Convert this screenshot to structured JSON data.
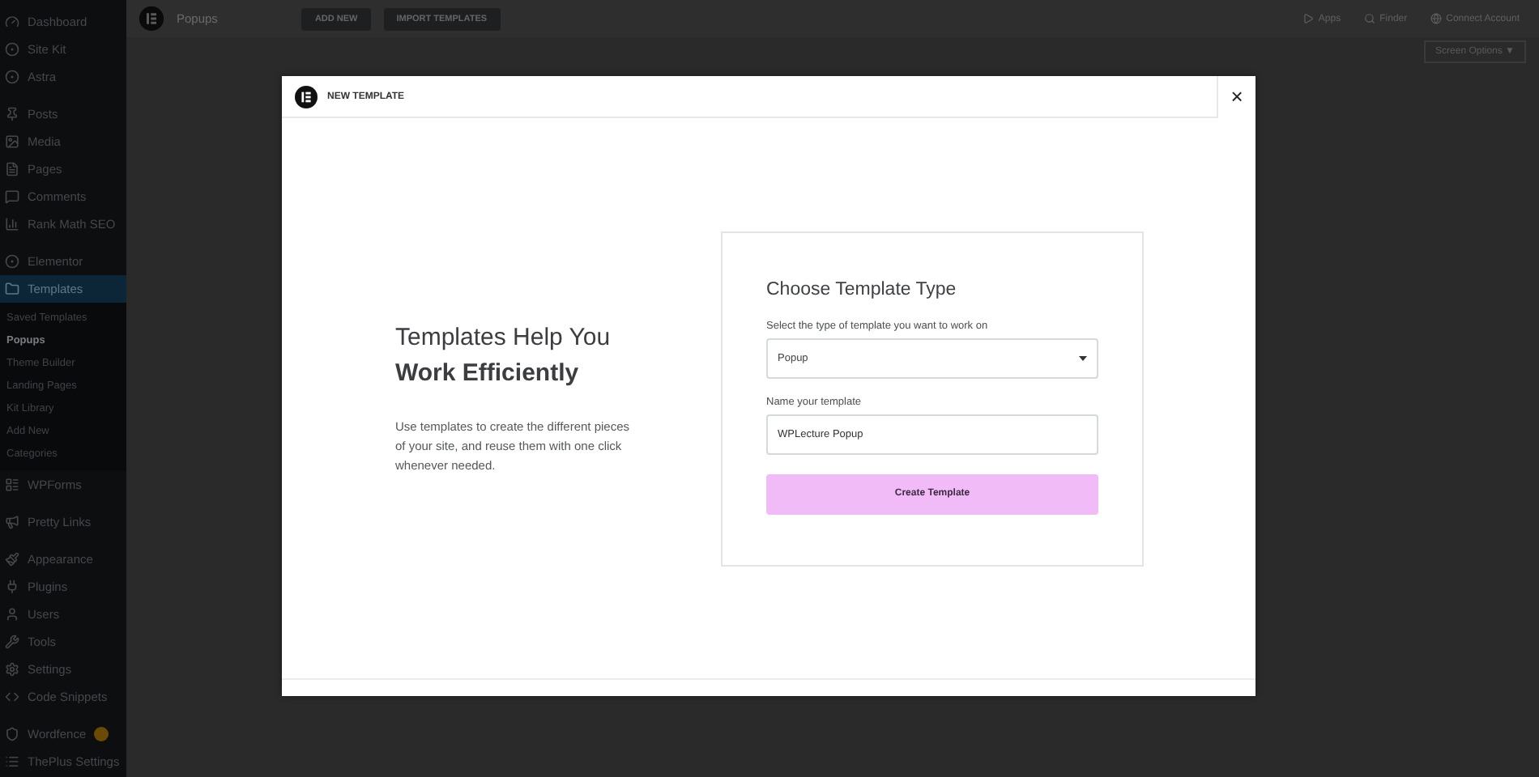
{
  "sidebar": {
    "groups": [
      {
        "items": [
          {
            "label": "Dashboard",
            "selected": false
          },
          {
            "label": "Site Kit",
            "selected": false
          },
          {
            "label": "Astra",
            "selected": false
          }
        ]
      },
      {
        "items": [
          {
            "label": "Posts",
            "selected": false
          },
          {
            "label": "Media",
            "selected": false
          },
          {
            "label": "Pages",
            "selected": false
          },
          {
            "label": "Comments",
            "selected": false
          },
          {
            "label": "Rank Math SEO",
            "selected": false
          }
        ]
      },
      {
        "items": [
          {
            "label": "Elementor",
            "selected": false
          },
          {
            "label": "Templates",
            "selected": true,
            "children": [
              {
                "label": "Saved Templates",
                "selected": false
              },
              {
                "label": "Popups",
                "selected": true
              },
              {
                "label": "Theme Builder",
                "selected": false
              },
              {
                "label": "Landing Pages",
                "selected": false
              },
              {
                "label": "Kit Library",
                "selected": false
              },
              {
                "label": "Add New",
                "selected": false
              },
              {
                "label": "Categories",
                "selected": false
              }
            ]
          },
          {
            "label": "WPForms",
            "selected": false
          }
        ]
      },
      {
        "items": [
          {
            "label": "Pretty Links",
            "selected": false
          }
        ]
      },
      {
        "items": [
          {
            "label": "Appearance",
            "selected": false
          },
          {
            "label": "Plugins",
            "selected": false
          },
          {
            "label": "Users",
            "selected": false
          },
          {
            "label": "Tools",
            "selected": false
          },
          {
            "label": "Settings",
            "selected": false
          },
          {
            "label": "Code Snippets",
            "selected": false
          }
        ]
      },
      {
        "items": [
          {
            "label": "Wordfence",
            "selected": false,
            "badge": true
          },
          {
            "label": "ThePlus Settings",
            "selected": false
          }
        ]
      }
    ]
  },
  "top_bar": {
    "title": "Popups",
    "buttons": [
      "ADD NEW",
      "IMPORT TEMPLATES"
    ],
    "links": [
      "Apps",
      "Finder",
      "Connect Account"
    ],
    "screen_options": "Screen Options ▼"
  },
  "modal": {
    "title": "NEW TEMPLATE",
    "close": "×",
    "heading": "Templates Help You **Work Efficiently**",
    "description": "Use templates to create the different pieces of your site, and reuse them with one click whenever needed.",
    "form": {
      "title": "Choose Template Type",
      "type_label": "Select the type of template you want to work on",
      "type_value": "Popup",
      "name_label": "Name your template",
      "name_value": "WPLecture Popup",
      "submit": "Create Template"
    }
  }
}
